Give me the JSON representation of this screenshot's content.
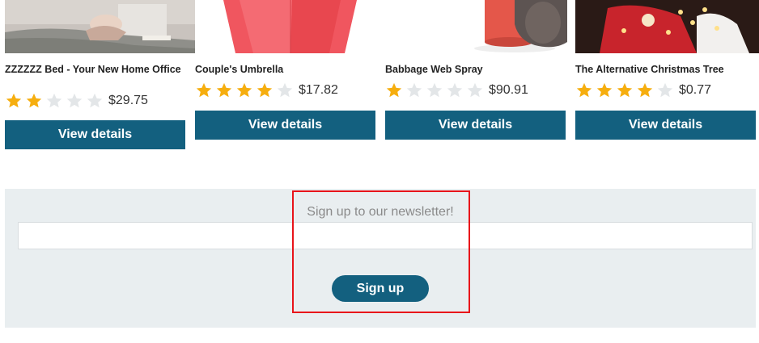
{
  "products": [
    {
      "title": "ZZZZZZ Bed - Your New Home Office",
      "rating": 2,
      "price": "$29.75",
      "button_label": "View details"
    },
    {
      "title": "Couple's Umbrella",
      "rating": 4,
      "price": "$17.82",
      "button_label": "View details"
    },
    {
      "title": "Babbage Web Spray",
      "rating": 1,
      "price": "$90.91",
      "button_label": "View details"
    },
    {
      "title": "The Alternative Christmas Tree",
      "rating": 4,
      "price": "$0.77",
      "button_label": "View details"
    }
  ],
  "rating_max": 5,
  "newsletter": {
    "title": "Sign up to our newsletter!",
    "email_value": "",
    "signup_label": "Sign up"
  },
  "colors": {
    "primary_button": "#13607f",
    "star_filled": "#f6ae0f",
    "star_empty": "#e3e6e8",
    "newsletter_bg": "#e9eef0",
    "highlight_border": "#e8141a"
  }
}
